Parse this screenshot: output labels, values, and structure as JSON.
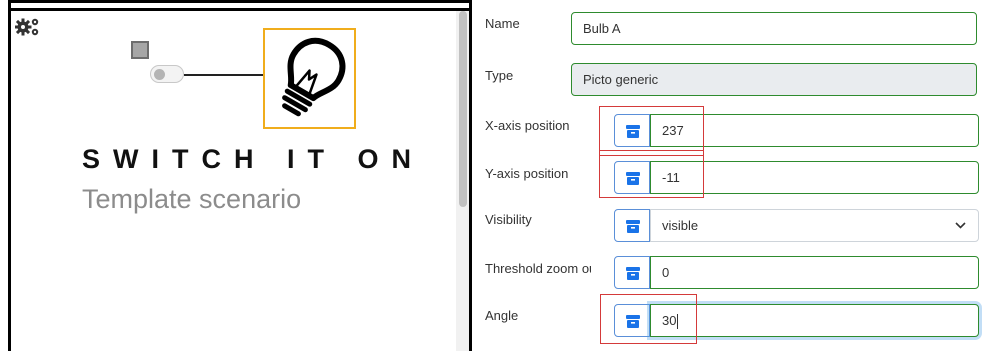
{
  "canvas": {
    "title": "SWITCH IT ON",
    "subtitle": "Template scenario",
    "icons": {
      "settings": "gears-icon",
      "element": "square-icon",
      "switch": "toggle-switch-icon",
      "bulb": "lightbulb-icon"
    },
    "colors": {
      "selection": "#f0ad1c",
      "title": "#111111",
      "subtitle": "#8c8c8c"
    }
  },
  "properties": {
    "name": {
      "label": "Name",
      "value": "Bulb A"
    },
    "type": {
      "label": "Type",
      "value": "Picto generic"
    },
    "x_position": {
      "label": "X-axis position",
      "value": "237"
    },
    "y_position": {
      "label": "Y-axis position",
      "value": "-11"
    },
    "visibility": {
      "label": "Visibility",
      "value": "visible"
    },
    "threshold_zoom": {
      "label": "Threshold zoom ou",
      "value": "0"
    },
    "angle": {
      "label": "Angle",
      "value": "30"
    },
    "button_icon": "archive-box-icon",
    "colors": {
      "field_border": "#2e8b2e",
      "button_icon": "#1a73e8",
      "highlight": "#d43a3a"
    }
  }
}
